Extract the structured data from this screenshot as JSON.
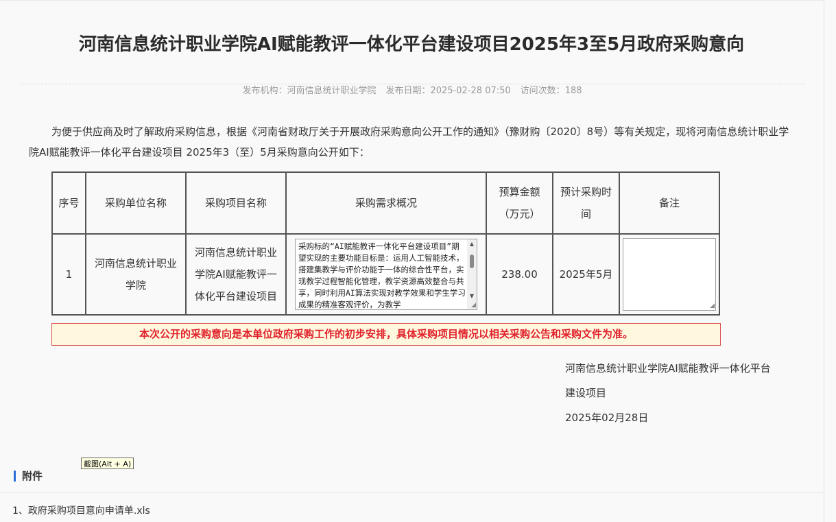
{
  "article": {
    "title": "河南信息统计职业学院AI赋能教评一体化平台建设项目2025年3至5月政府采购意向",
    "meta": {
      "publisher_label": "发布机构：",
      "publisher": "河南信息统计职业学院",
      "date_label": "发布日期：",
      "date": "2025-02-28 07:50",
      "visits_label": "访问次数：",
      "visits": "188"
    },
    "intro": "为便于供应商及时了解政府采购信息，根据《河南省财政厅关于开展政府采购意向公开工作的通知》（豫财购〔2020〕8号）等有关规定，现将河南信息统计职业学院AI赋能教评一体化平台建设项目 2025年3（至）5月采购意向公开如下："
  },
  "table": {
    "headers": {
      "index": "序号",
      "unit": "采购单位名称",
      "project": "采购项目名称",
      "summary": "采购需求概况",
      "budget_line1": "预算金额",
      "budget_line2": "（万元）",
      "time_line1": "预计采购时",
      "time_line2": "间",
      "remark": "备注"
    },
    "rows": [
      {
        "index": "1",
        "unit": "河南信息统计职业学院",
        "project": "河南信息统计职业学院AI赋能教评一体化平台建设项目",
        "summary": "采购标的“AI赋能教评一体化平台建设项目”期望实现的主要功能目标是：运用人工智能技术，搭建集教学与评价功能于一体的综合性平台，实现教学过程智能化管理，教学资源高效整合与共享，同时利用AI算法实现对教学效果和学生学习成果的精准客观评价，为教学",
        "budget": "238.00",
        "time": "2025年5月",
        "remark": ""
      }
    ]
  },
  "notice": "本次公开的采购意向是本单位政府采购工作的初步安排，具体采购项目情况以相关采购公告和采购文件为准。",
  "signature": {
    "org_line1": "河南信息统计职业学院AI赋能教评一体化平台",
    "org_line2": "建设项目",
    "date": "2025年02月28日"
  },
  "tooltip": "截图(Alt + A)",
  "attachments": {
    "heading": "附件",
    "items": [
      {
        "label": "1、政府采购项目意向申请单.xls"
      }
    ]
  },
  "colors": {
    "notice_text": "#e0202a",
    "notice_border": "#d9534f",
    "notice_bg": "#fff8df",
    "accent_bar": "#2a6fd6"
  }
}
